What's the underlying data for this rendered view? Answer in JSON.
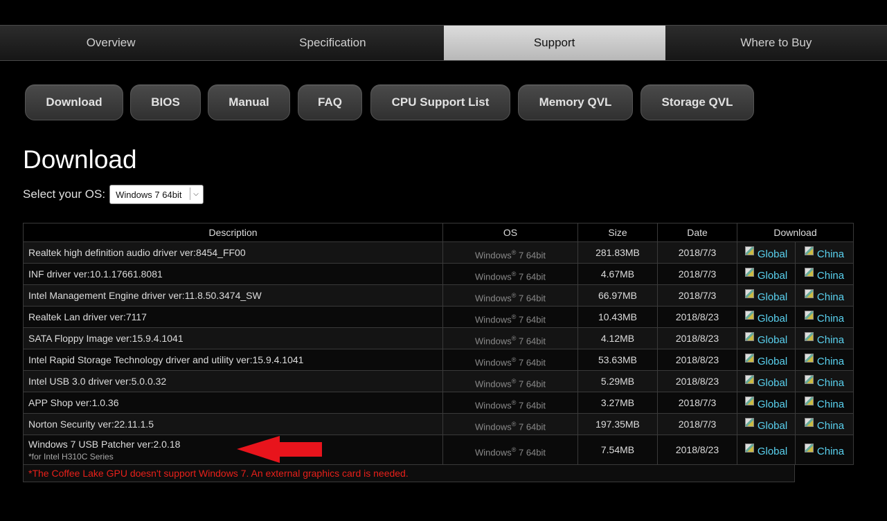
{
  "tabs": [
    {
      "label": "Overview",
      "active": false
    },
    {
      "label": "Specification",
      "active": false
    },
    {
      "label": "Support",
      "active": true
    },
    {
      "label": "Where to Buy",
      "active": false
    }
  ],
  "subnav": [
    "Download",
    "BIOS",
    "Manual",
    "FAQ",
    "CPU Support List",
    "Memory QVL",
    "Storage QVL"
  ],
  "page_title": "Download",
  "os_select": {
    "label": "Select your OS:",
    "value": "Windows 7 64bit"
  },
  "table": {
    "headers": {
      "description": "Description",
      "os": "OS",
      "size": "Size",
      "date": "Date",
      "download": "Download"
    },
    "os_text": {
      "prefix": "Windows",
      "mark": "®",
      "suffix": " 7 64bit"
    },
    "link_global": "Global",
    "link_china": "China",
    "rows": [
      {
        "desc": "Realtek high definition audio driver ver:8454_FF00",
        "size": "281.83MB",
        "date": "2018/7/3"
      },
      {
        "desc": "INF driver ver:10.1.17661.8081",
        "size": "4.67MB",
        "date": "2018/7/3"
      },
      {
        "desc": "Intel Management Engine driver ver:11.8.50.3474_SW",
        "size": "66.97MB",
        "date": "2018/7/3"
      },
      {
        "desc": "Realtek Lan driver ver:7117",
        "size": "10.43MB",
        "date": "2018/8/23"
      },
      {
        "desc": "SATA Floppy Image ver:15.9.4.1041",
        "size": "4.12MB",
        "date": "2018/8/23"
      },
      {
        "desc": "Intel Rapid Storage Technology driver and utility ver:15.9.4.1041",
        "size": "53.63MB",
        "date": "2018/8/23"
      },
      {
        "desc": "Intel USB 3.0 driver ver:5.0.0.32",
        "size": "5.29MB",
        "date": "2018/8/23"
      },
      {
        "desc": "APP Shop ver:1.0.36",
        "size": "3.27MB",
        "date": "2018/7/3"
      },
      {
        "desc": "Norton Security ver:22.11.1.5",
        "size": "197.35MB",
        "date": "2018/7/3"
      },
      {
        "desc": "Windows 7 USB Patcher ver:2.0.18",
        "note": "*for Intel H310C Series",
        "size": "7.54MB",
        "date": "2018/8/23"
      }
    ]
  },
  "warning": "*The Coffee Lake GPU doesn't support Windows 7. An external graphics card is needed.",
  "colors": {
    "link": "#5ad2f0",
    "warning": "#e8201a",
    "annotation_arrow": "#e8141c"
  }
}
